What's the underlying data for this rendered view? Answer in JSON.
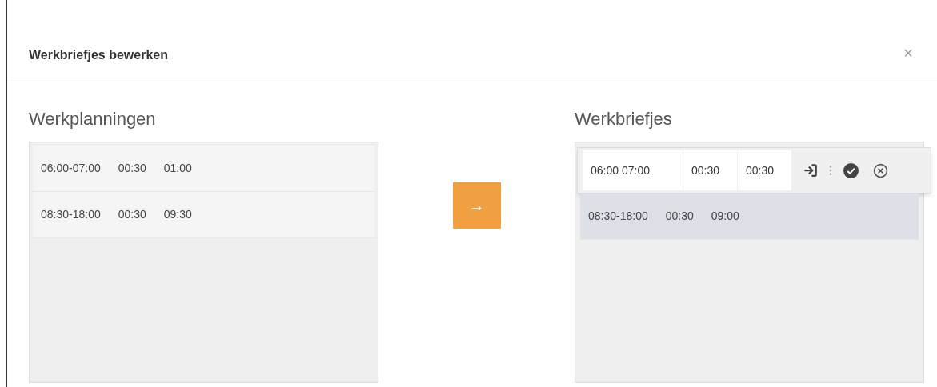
{
  "dialog": {
    "title": "Werkbriefjes bewerken",
    "close": "×"
  },
  "planning": {
    "heading": "Werkplanningen",
    "rows": [
      {
        "cells": [
          "06:00-07:00",
          "00:30",
          "01:00"
        ]
      },
      {
        "cells": [
          "08:30-18:00",
          "00:30",
          "09:30"
        ]
      }
    ]
  },
  "transfer_button": {
    "label": "→"
  },
  "briefjes": {
    "heading": "Werkbriefjes",
    "rows": [
      {
        "kind": "editing",
        "selected": false,
        "cells": [
          "06:00 07:00",
          "00:30",
          "00:30"
        ]
      },
      {
        "kind": "plain",
        "selected": true,
        "cells": [
          "08:30-18:00",
          "00:30",
          "09:00"
        ]
      }
    ]
  }
}
